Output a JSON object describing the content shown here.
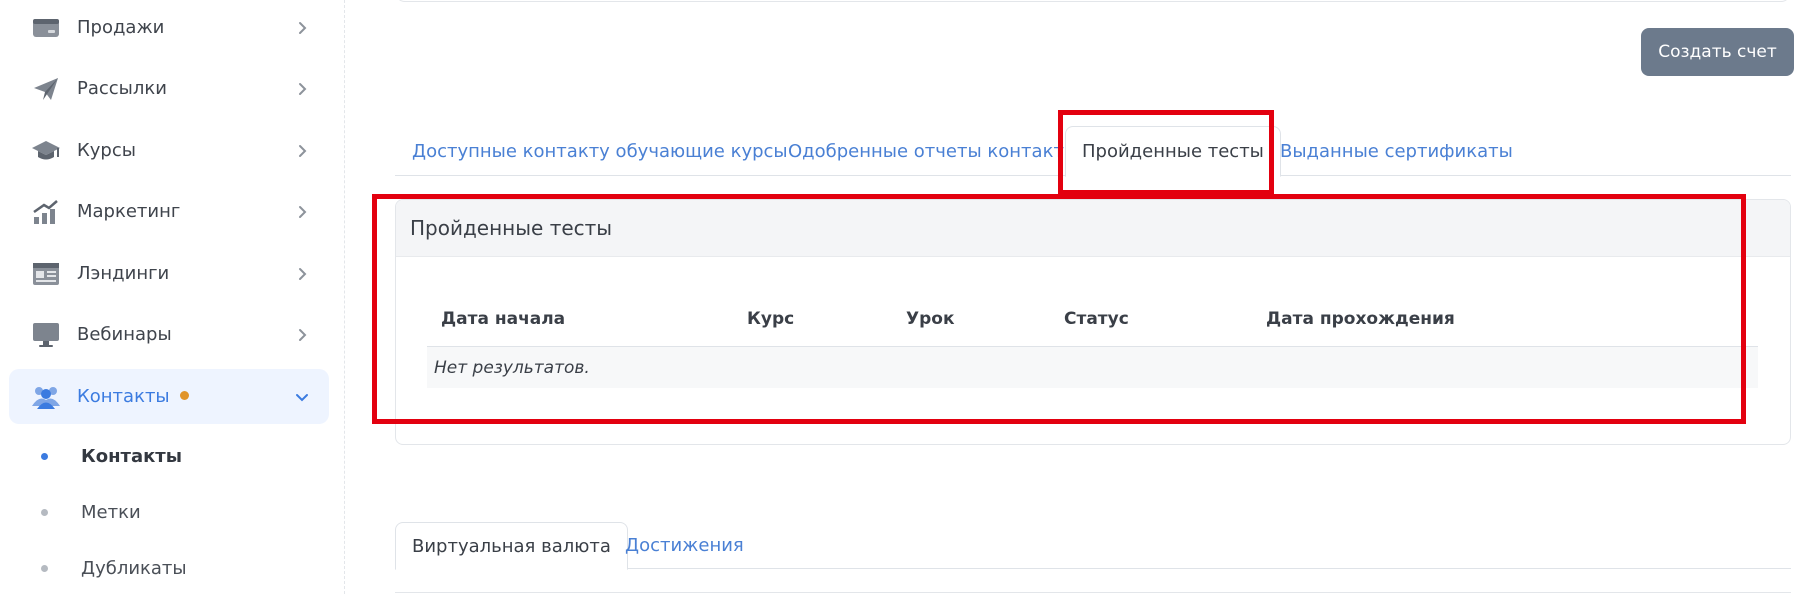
{
  "sidebar": {
    "items": [
      {
        "label": "Продажи",
        "icon": "credit-card-icon"
      },
      {
        "label": "Рассылки",
        "icon": "paper-plane-icon"
      },
      {
        "label": "Курсы",
        "icon": "graduation-cap-icon"
      },
      {
        "label": "Маркетинг",
        "icon": "chart-growth-icon"
      },
      {
        "label": "Лэндинги",
        "icon": "landing-page-icon"
      },
      {
        "label": "Вебинары",
        "icon": "monitor-icon"
      },
      {
        "label": "Контакты",
        "icon": "users-icon",
        "active": true
      }
    ],
    "sub_items": [
      {
        "label": "Контакты",
        "active": true
      },
      {
        "label": "Метки"
      },
      {
        "label": "Дубликаты"
      }
    ]
  },
  "toolbar": {
    "create_invoice_label": "Создать счет"
  },
  "tabs": [
    {
      "label": "Доступные контакту обучающие курсы"
    },
    {
      "label": "Одобренные отчеты контакта"
    },
    {
      "label": "Пройденные тесты",
      "active": true
    },
    {
      "label": "Выданные сертификаты"
    }
  ],
  "panel": {
    "title": "Пройденные тесты",
    "columns": [
      "Дата начала",
      "Курс",
      "Урок",
      "Статус",
      "Дата прохождения"
    ],
    "empty_text": "Нет результатов."
  },
  "tabs_bottom": [
    {
      "label": "Виртуальная валюта",
      "active": true
    },
    {
      "label": "Достижения"
    }
  ],
  "colors": {
    "accent": "#3b7be0",
    "highlight": "#e3000f",
    "badge": "#e0952c",
    "button": "#6c7a8c"
  }
}
